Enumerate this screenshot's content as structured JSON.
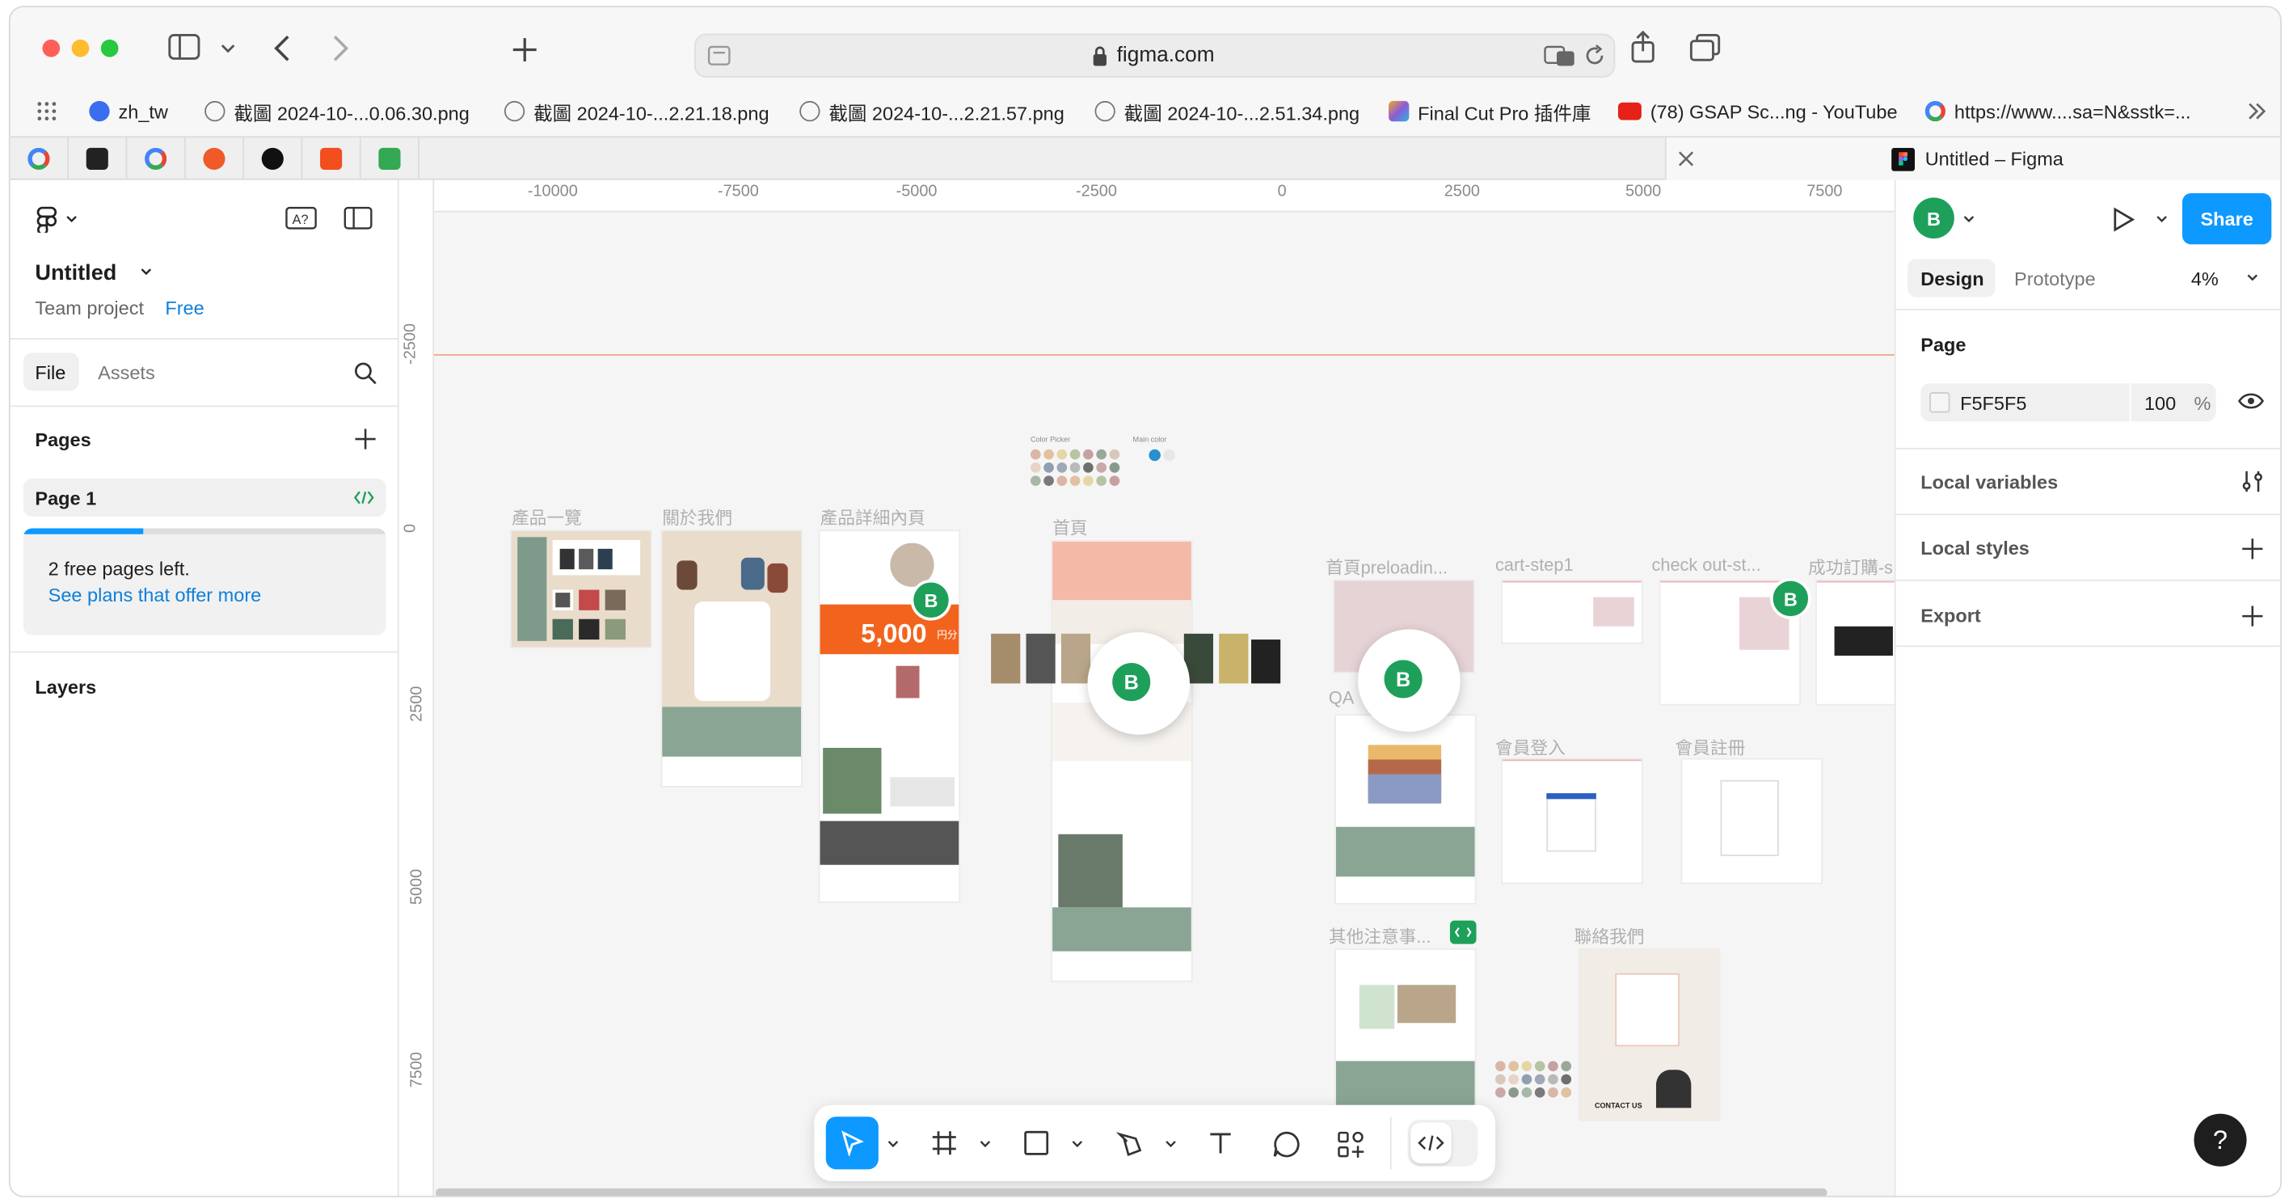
{
  "browser": {
    "url": "figma.com",
    "bookmarks": [
      {
        "label": "zh_tw",
        "color": "#3a6df0"
      },
      {
        "label": "截圖 2024-10-...0.06.30.png",
        "color": "#777777"
      },
      {
        "label": "截圖 2024-10-...2.21.18.png",
        "color": "#777777"
      },
      {
        "label": "截圖 2024-10-...2.21.57.png",
        "color": "#777777"
      },
      {
        "label": "截圖 2024-10-...2.51.34.png",
        "color": "#777777"
      },
      {
        "label": "Final Cut Pro 插件庫",
        "color": "#8a5cd8"
      },
      {
        "label": "(78) GSAP Sc...ng - YouTube",
        "color": "#e62117"
      },
      {
        "label": "https://www....sa=N&sstk=...",
        "color": "#4285f4"
      }
    ],
    "active_tab_title": "Untitled – Figma",
    "pinned_tab_colors": [
      "#4285f4",
      "#222222",
      "#4285f4",
      "#f05a28",
      "#111111",
      "#f24e1e",
      "#34a853"
    ]
  },
  "left_panel": {
    "file_name": "Untitled",
    "team": "Team project",
    "plan": "Free",
    "tabs": [
      "File",
      "Assets"
    ],
    "pages_header": "Pages",
    "page": "Page 1",
    "free_pages": "2 free pages left.",
    "plans_link": "See plans that offer more",
    "free_pages_used": 0.33,
    "layers_header": "Layers"
  },
  "canvas": {
    "ruler_x": [
      "-10000",
      "-7500",
      "-5000",
      "-2500",
      "0",
      "2500",
      "5000",
      "7500"
    ],
    "ruler_y": [
      "-2500",
      "0",
      "2500",
      "5000",
      "7500"
    ],
    "frame_labels": [
      "產品一覽",
      "關於我們",
      "產品詳細內頁",
      "首頁",
      "首頁preloadin...",
      "cart-step1",
      "check out-st...",
      "成功訂購-s",
      "QA",
      "會員登入",
      "會員註冊",
      "其他注意事...",
      "聯絡我們"
    ],
    "palette_labels": [
      "Color Picker",
      "Main color"
    ],
    "promo_text": "5,000",
    "promo_unit": "円分",
    "contact_text": "CONTACT US",
    "avatar_letter": "B"
  },
  "toolbar": {
    "tools": [
      "move-tool",
      "frame-tool",
      "shape-tool",
      "pen-tool",
      "text-tool",
      "comment-tool",
      "actions-tool",
      "dev-mode-toggle"
    ]
  },
  "right_panel": {
    "tabs": [
      "Design",
      "Prototype"
    ],
    "zoom": "4%",
    "share": "Share",
    "page_header": "Page",
    "bg_color": "F5F5F5",
    "bg_opacity": "100",
    "percent": "%",
    "sections": [
      "Local variables",
      "Local styles",
      "Export"
    ]
  },
  "help": "?"
}
